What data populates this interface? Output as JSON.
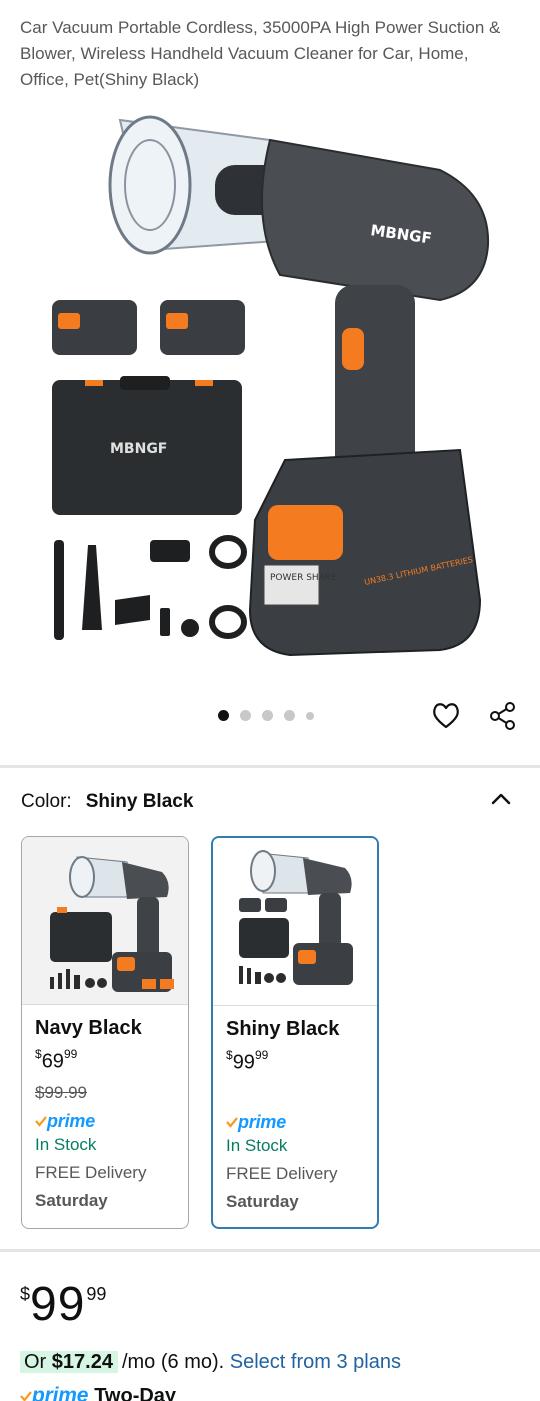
{
  "product": {
    "title": "Car Vacuum Portable Cordless, 35000PA High Power Suction & Blower, Wireless Handheld Vacuum Cleaner for Car, Home, Office, Pet(Shiny Black)",
    "image_brand": "MBNGF",
    "battery_text": "POWER SHARE",
    "battery_label": "UN38.3 LITHIUM BATTERIES"
  },
  "gallery": {
    "active_index": 0,
    "dot_count": 5
  },
  "color": {
    "label": "Color:",
    "selected": "Shiny Black"
  },
  "variants": [
    {
      "name": "Navy Black",
      "price_symbol": "$",
      "price_whole": "69",
      "price_fraction": "99",
      "list_price": "$99.99",
      "prime": "prime",
      "stock": "In Stock",
      "delivery": "FREE Delivery",
      "delivery_day": "Saturday",
      "selected": false
    },
    {
      "name": "Shiny Black",
      "price_symbol": "$",
      "price_whole": "99",
      "price_fraction": "99",
      "list_price": "",
      "prime": "prime",
      "stock": "In Stock",
      "delivery": "FREE Delivery",
      "delivery_day": "Saturday",
      "selected": true
    }
  ],
  "price": {
    "symbol": "$",
    "whole": "99",
    "fraction": "99"
  },
  "installment": {
    "prefix": "Or",
    "amount": "$17.24",
    "term": "/mo (6 mo).",
    "link": "Select from 3 plans"
  },
  "shipping": {
    "prime": "prime",
    "text": "Two-Day"
  },
  "colors": {
    "prime_blue": "#1399ff",
    "link_blue": "#2162a1",
    "stock_green": "#067d62",
    "orange": "#f47b20",
    "selected_border": "#2f7bb2"
  }
}
